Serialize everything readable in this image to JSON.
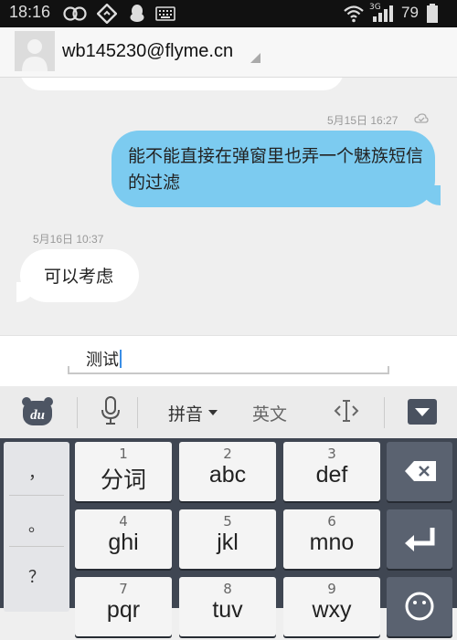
{
  "status_bar": {
    "time": "18:16",
    "battery": "79",
    "network": "3G",
    "icons": [
      "infinity-icon",
      "compass-icon",
      "qq-penguin-icon",
      "keyboard-icon",
      "wifi-icon",
      "signal-icon"
    ]
  },
  "header": {
    "contact": "wb145230@flyme.cn"
  },
  "conversation": {
    "messages": [
      {
        "direction": "outgoing",
        "timestamp": "5月15日 16:27",
        "text": "能不能直接在弹窗里也弄一个魅族短信的过滤"
      },
      {
        "direction": "incoming",
        "timestamp": "5月16日 10:37",
        "text": "可以考虑"
      }
    ]
  },
  "compose": {
    "value": "测试"
  },
  "ime_toolbar": {
    "logo": "du",
    "pinyin": "拼音",
    "english": "英文",
    "icons": [
      "baidu-du-icon",
      "microphone-icon",
      "cursor-move-icon",
      "hide-keyboard-icon"
    ]
  },
  "keyboard": {
    "punctuation": [
      "，",
      "。",
      "？"
    ],
    "keys": [
      {
        "num": "1",
        "label": "分词"
      },
      {
        "num": "2",
        "label": "abc"
      },
      {
        "num": "3",
        "label": "def"
      },
      {
        "num": "4",
        "label": "ghi"
      },
      {
        "num": "5",
        "label": "jkl"
      },
      {
        "num": "6",
        "label": "mno"
      },
      {
        "num": "7",
        "label": "pqr"
      },
      {
        "num": "8",
        "label": "tuv"
      },
      {
        "num": "9",
        "label": "wxy"
      }
    ],
    "function_keys": [
      "backspace-icon",
      "enter-icon",
      "emoji-icon"
    ]
  },
  "colors": {
    "outgoing_bubble": "#7ccbf0",
    "incoming_bubble": "#ffffff",
    "keyboard_bg": "#3f4652",
    "status_bar": "#111111"
  }
}
